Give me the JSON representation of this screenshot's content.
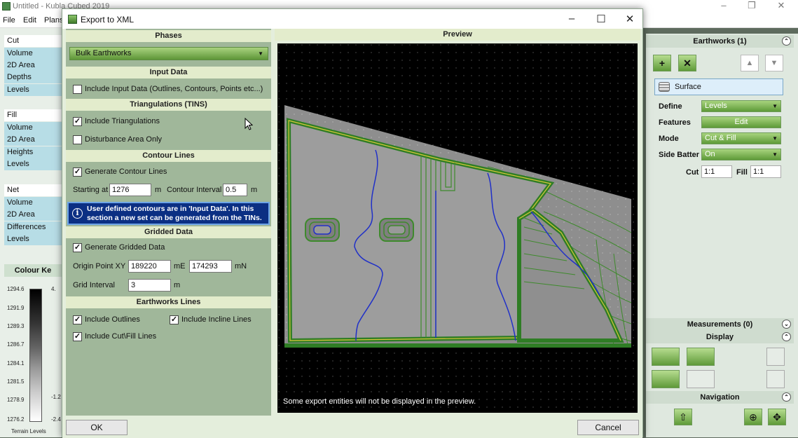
{
  "app": {
    "title": "Untitled - Kubla Cubed 2019",
    "menu": [
      "File",
      "Edit",
      "Plans"
    ]
  },
  "left_panel": {
    "cut": {
      "head": "Cut",
      "items": [
        "Volume",
        "2D Area",
        "Depths",
        "Levels"
      ]
    },
    "fill": {
      "head": "Fill",
      "items": [
        "Volume",
        "2D Area",
        "Heights",
        "Levels"
      ]
    },
    "net": {
      "head": "Net",
      "items": [
        "Volume",
        "2D Area",
        "Differences",
        "Levels"
      ]
    },
    "colour_title": "Colour Ke",
    "scale_labels": [
      "1294.6",
      "1291.9",
      "1289.3",
      "1286.7",
      "1284.1",
      "1281.5",
      "1278.9",
      "1276.2"
    ],
    "scale_right": [
      "4.",
      "-1.2",
      "-2.4"
    ],
    "footer": "Terrain Levels"
  },
  "dialog": {
    "title": "Export to XML",
    "phases_head": "Phases",
    "phase_value": "Bulk Earthworks",
    "input_data_head": "Input Data",
    "include_input_label": "Include Input Data (Outlines, Contours, Points etc...)",
    "tins_head": "Triangulations (TINS)",
    "include_tri_label": "Include Triangulations",
    "disturbance_label": "Disturbance Area Only",
    "contour_head": "Contour Lines",
    "gen_contour_label": "Generate Contour Lines",
    "starting_at_label": "Starting at",
    "starting_at_value": "1276",
    "m_unit": "m",
    "contour_interval_label": "Contour Interval",
    "contour_interval_value": "0.5",
    "info_text": "User defined contours are in 'Input Data'. In this section a new set can be generated from the TINs.",
    "gridded_head": "Gridded Data",
    "gen_gridded_label": "Generate Gridded Data",
    "origin_label": "Origin Point XY",
    "origin_x": "189220",
    "me_unit": "mE",
    "origin_y": "174293",
    "mn_unit": "mN",
    "grid_interval_label": "Grid Interval",
    "grid_interval_value": "3",
    "earthworks_head": "Earthworks Lines",
    "include_outlines_label": "Include Outlines",
    "include_incline_label": "Include Incline Lines",
    "include_cutfill_label": "Include Cut\\Fill Lines",
    "preview_head": "Preview",
    "preview_note": "Some export entities will not be displayed in the preview.",
    "ok_label": "OK",
    "cancel_label": "Cancel"
  },
  "right_panel": {
    "earthworks_head": "Earthworks (1)",
    "surface_label": "Surface",
    "define_label": "Define",
    "define_value": "Levels",
    "features_label": "Features",
    "features_button": "Edit",
    "mode_label": "Mode",
    "mode_value": "Cut & Fill",
    "side_batter_label": "Side Batter",
    "side_batter_value": "On",
    "cut_label": "Cut",
    "cut_value": "1:1",
    "fill_label": "Fill",
    "fill_value": "1:1",
    "measurements_head": "Measurements (0)",
    "display_head": "Display",
    "navigation_head": "Navigation"
  }
}
